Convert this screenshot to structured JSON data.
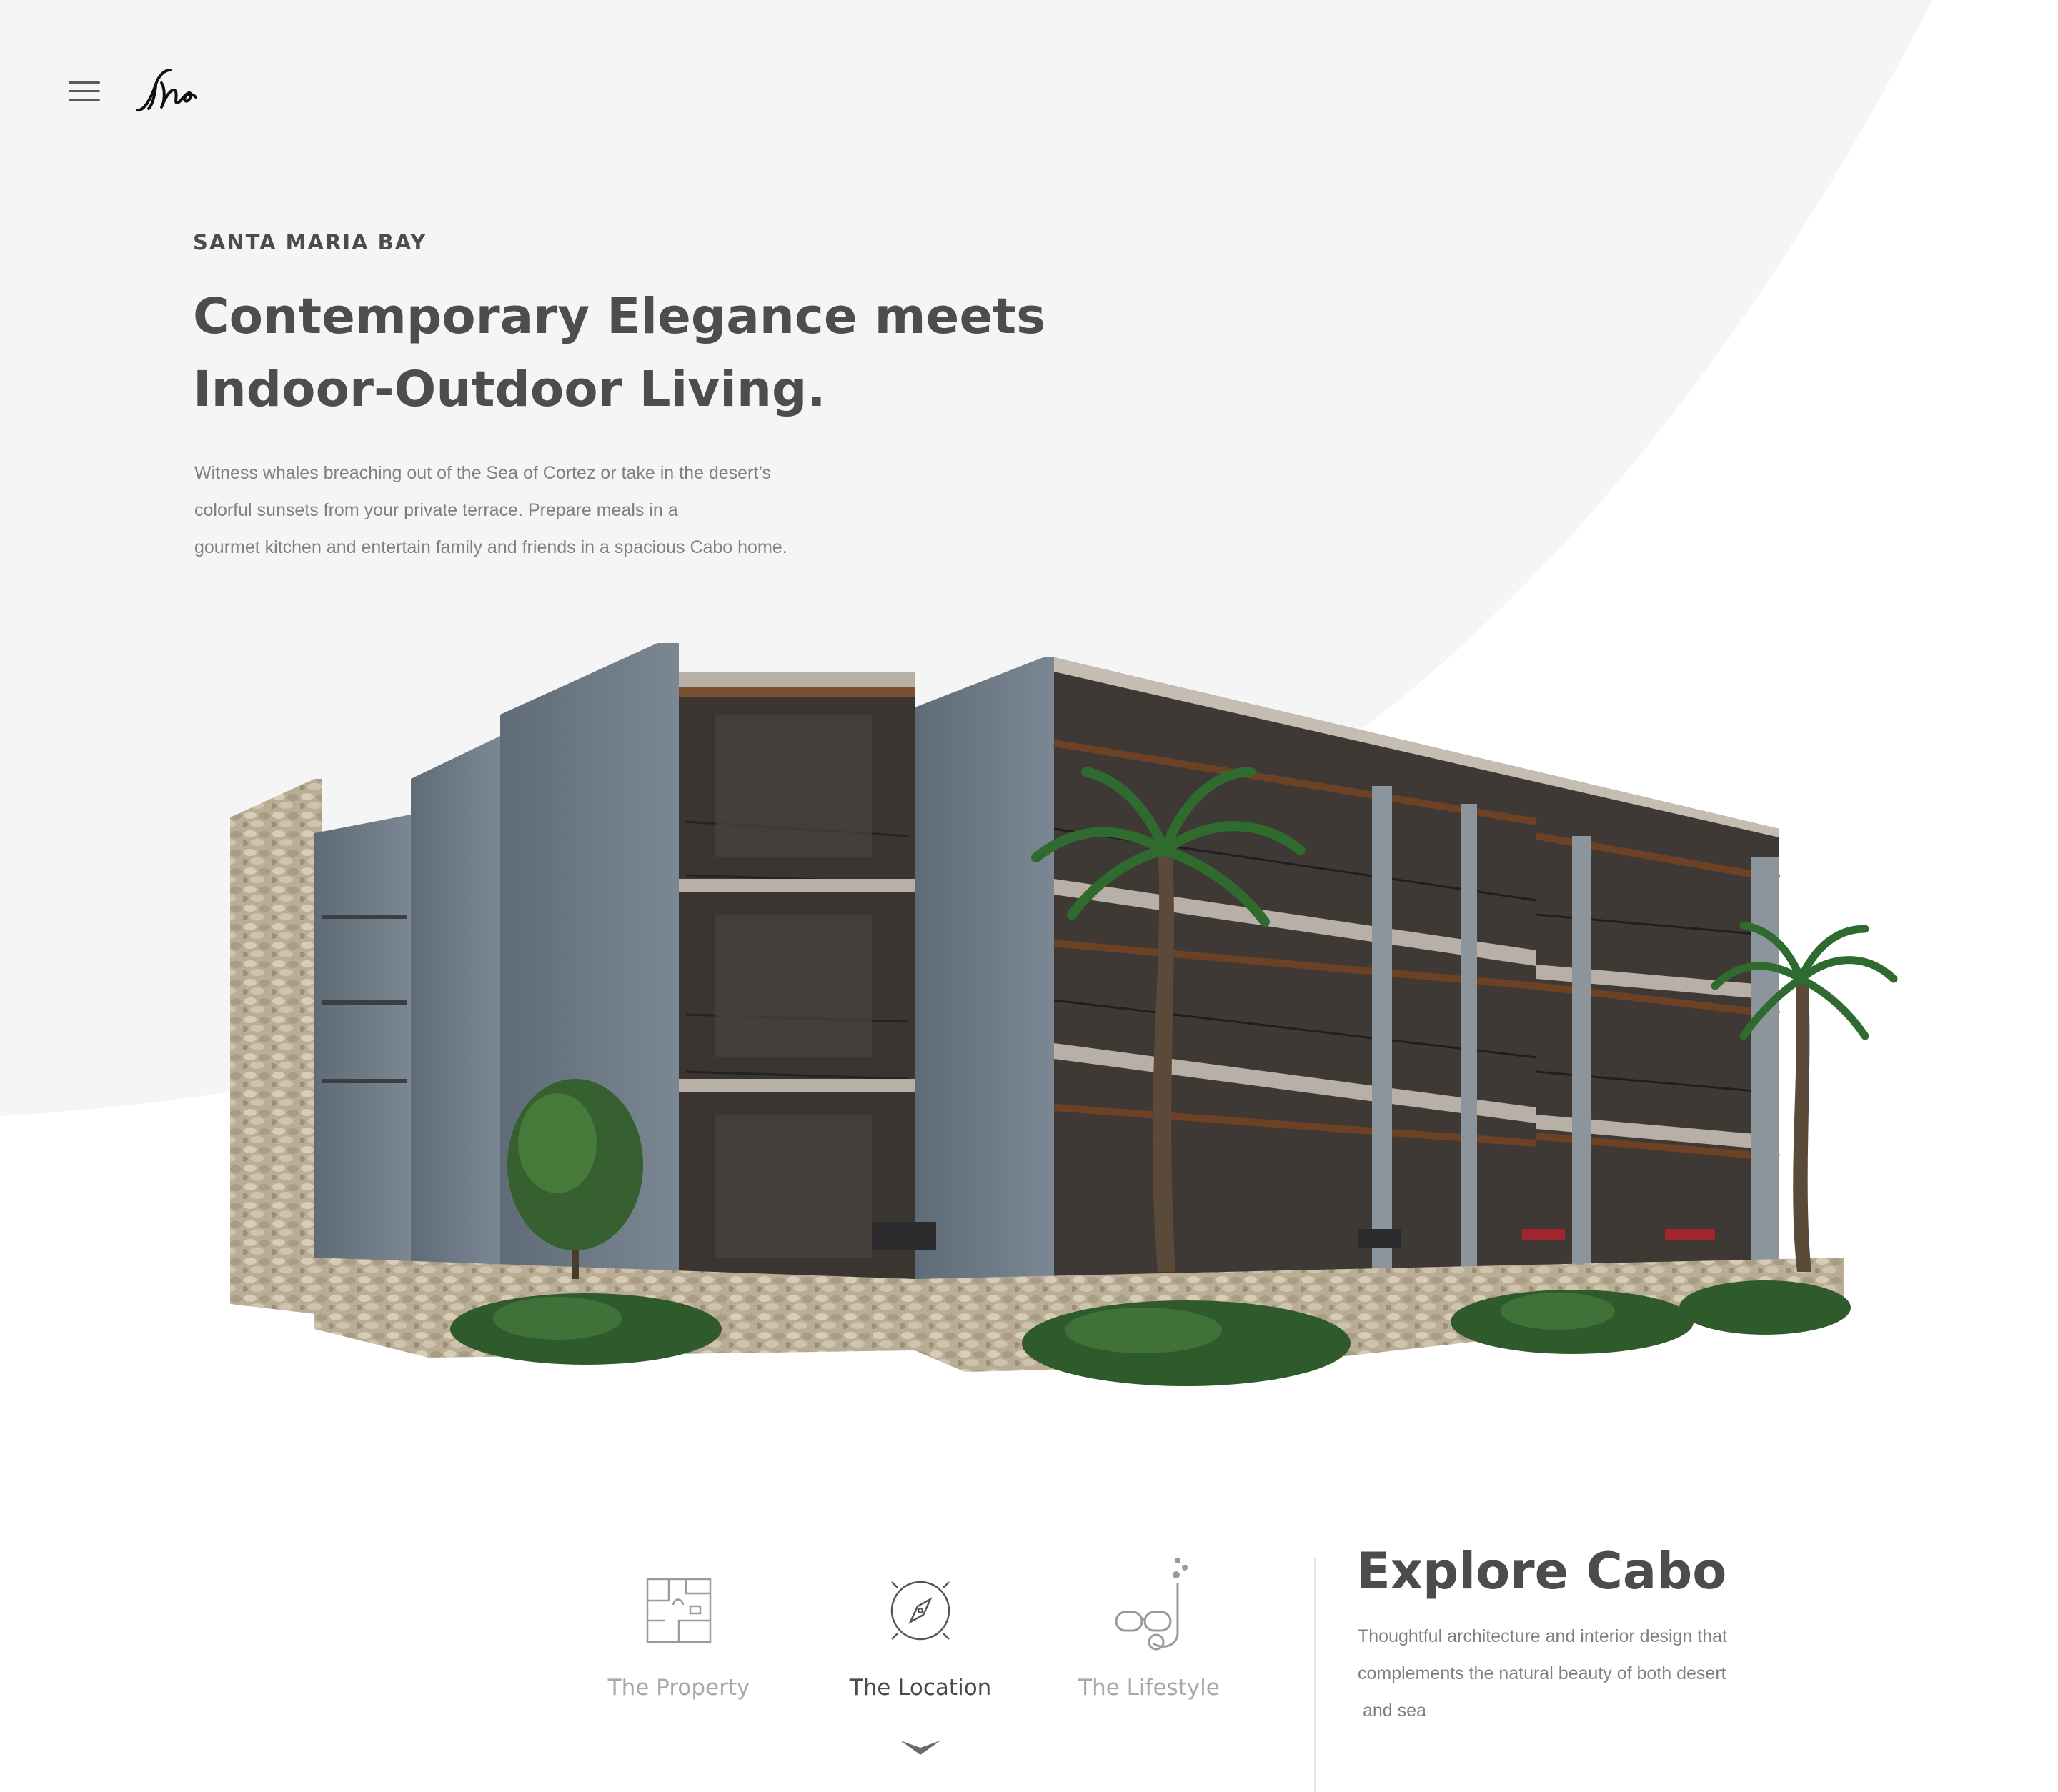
{
  "header": {
    "menu_icon": "hamburger-menu-icon",
    "logo_icon": "signature-logo-icon"
  },
  "hero": {
    "eyebrow": "SANTA MARIA BAY",
    "title_lines": [
      "Contemporary Elegance meets",
      "Indoor-Outdoor Living."
    ],
    "description_lines": [
      "Witness whales breaching out of the Sea of Cortez or take in the desert’s",
      "colorful sunsets from your private terrace. Prepare meals in a",
      "gourmet kitchen and entertain family and friends in a spacious Cabo home."
    ],
    "image_icon": "building-illustration"
  },
  "nav": {
    "items": [
      {
        "label": "The Property",
        "icon": "floor-plan-icon",
        "active": false
      },
      {
        "label": "The Location",
        "icon": "compass-icon",
        "active": true
      },
      {
        "label": "The Lifestyle",
        "icon": "snorkel-icon",
        "active": false
      }
    ],
    "active_indicator_icon": "chevron-down-icon"
  },
  "explore": {
    "title": "Explore Cabo",
    "description_lines": [
      "Thoughtful architecture and interior design that",
      "complements the natural beauty of both desert",
      " and sea"
    ]
  },
  "colors": {
    "hero_background": "#f5f5f5",
    "text_dark": "#4c4c4c",
    "text_muted": "#808080",
    "nav_inactive": "#a8a8a8"
  }
}
